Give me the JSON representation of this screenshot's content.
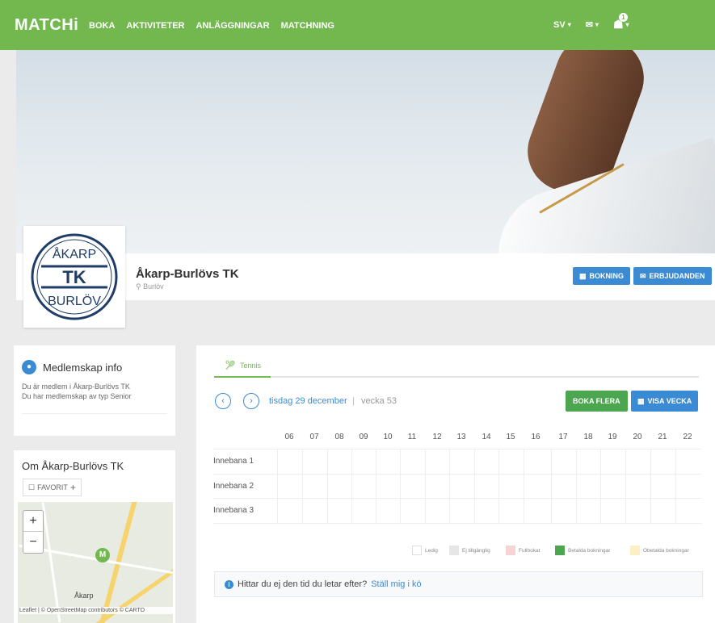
{
  "nav": {
    "logo": "MATCHi",
    "links": [
      "BOKA",
      "AKTIVITETER",
      "ANLÄGGNINGAR",
      "MATCHNING"
    ],
    "lang": "SV",
    "notification_count": "1"
  },
  "club": {
    "name": "Åkarp-Burlövs TK",
    "location": "Burlöv",
    "logo_top": "ÅKARP",
    "logo_mid": "TK",
    "logo_bottom": "BURLÖV",
    "booking_label": "BOKNING",
    "offers_label": "ERBJUDANDEN"
  },
  "membership": {
    "title": "Medlemskap info",
    "line1": "Du är medlem i Åkarp-Burlövs TK",
    "line2": "Du har medlemskap av typ Senior"
  },
  "about": {
    "title": "Om Åkarp-Burlövs TK",
    "favorite_label": "FAVORIT",
    "map_place": "Åkarp",
    "map_marker": "M",
    "attribution": "Leaflet | © OpenStreetMap contributors © CARTO"
  },
  "schedule": {
    "tab_label": "Tennis",
    "date": "tisdag 29 december",
    "separator": "|",
    "week": "vecka 53",
    "book_multiple_label": "BOKA FLERA",
    "show_week_label": "VISA VECKA",
    "hours": [
      "06",
      "07",
      "08",
      "09",
      "10",
      "11",
      "12",
      "13",
      "14",
      "15",
      "16",
      "17",
      "18",
      "19",
      "20",
      "21",
      "22"
    ],
    "courts": [
      "Innebana 1",
      "Innebana 2",
      "Innebana 3"
    ],
    "legend": [
      {
        "label": "Ledig",
        "color": "#ffffff"
      },
      {
        "label": "Ej tillgänglig",
        "color": "#e6e6e6"
      },
      {
        "label": "Fullbokat",
        "color": "#f6d4d6"
      },
      {
        "label": "Betalda bokningar",
        "color": "#4ca64f"
      },
      {
        "label": "Obetalda bokningar",
        "color": "#fbefc4"
      }
    ],
    "info_text": "Hittar du ej den tid du letar efter?",
    "info_link": "Ställ mig i kö"
  }
}
